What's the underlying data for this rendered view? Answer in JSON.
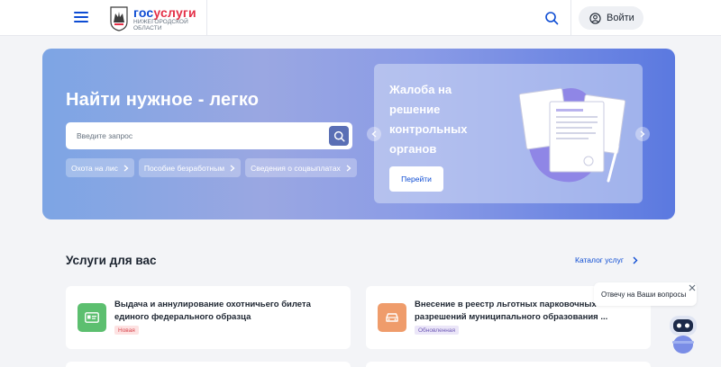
{
  "header": {
    "brand_part1": "гос",
    "brand_part2": "услуги",
    "region_line1": "Нижегородской",
    "region_line2": "области",
    "login_label": "Войти"
  },
  "hero": {
    "title": "Найти нужное - легко",
    "search_placeholder": "Введите запрос",
    "chips": [
      {
        "label": "Охота на лис"
      },
      {
        "label": "Пособие безработным"
      },
      {
        "label": "Сведения о соцвыплатах"
      }
    ],
    "promo": {
      "title": "Жалоба на решение контрольных органов",
      "button_label": "Перейти"
    }
  },
  "services": {
    "title": "Услуги для вас",
    "catalog_label": "Каталог услуг",
    "cards": [
      {
        "title": "Выдача и аннулирование охотничьего билета единого федерального образца",
        "badge": "Новая",
        "icon": "id-card-icon"
      },
      {
        "title": "Внесение в реестр льготных парковочных разрешений муниципального образования ...",
        "badge": "Обновленная",
        "icon": "car-icon"
      }
    ]
  },
  "chat": {
    "bubble_text": "Отвечу на Ваши вопросы"
  },
  "colors": {
    "accent": "#0d4cd3",
    "brand_red": "#e42f47",
    "card_icon_green": "#5cbf6f",
    "card_icon_orange": "#ef9c6b"
  }
}
